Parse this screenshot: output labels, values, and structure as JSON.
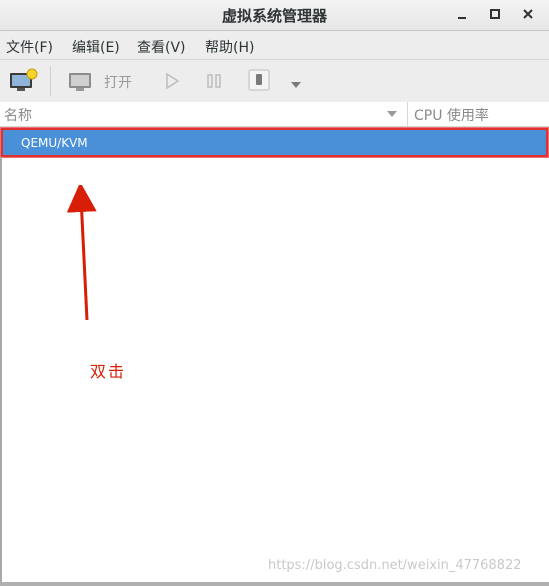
{
  "window": {
    "title": "虚拟系统管理器",
    "minimize": "▁",
    "maximize": "□",
    "close": "✕"
  },
  "menu": [
    "文件(F)",
    "编辑(E)",
    "查看(V)",
    "帮助(H)"
  ],
  "toolbar": {
    "new_vm_icon": "new-vm-icon",
    "open_label": "打开",
    "run_icon": "play-icon",
    "pause_icon": "pause-icon",
    "shutdown_icon": "power-icon",
    "menu_icon": "dropdown-icon"
  },
  "columns": {
    "name": "名称",
    "cpu": "CPU 使用率"
  },
  "connections": [
    {
      "label": "QEMU/KVM",
      "selected": true
    }
  ],
  "annotation": {
    "text": "双击",
    "color": "#d81e06"
  },
  "watermark": "https://blog.csdn.net/weixin_47768822",
  "colors": {
    "selection": "#4a90d9",
    "highlight_box": "#e03030"
  }
}
